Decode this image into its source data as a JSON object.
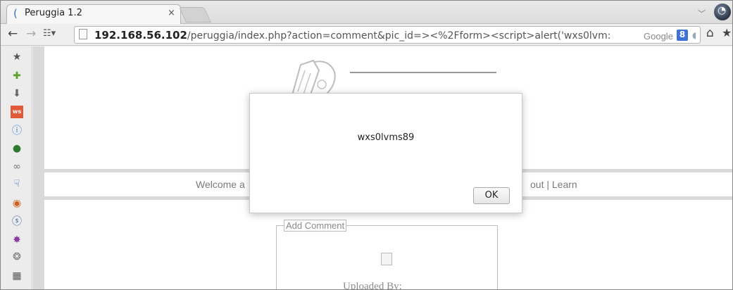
{
  "tab": {
    "title": "Peruggia 1.2",
    "close": "×",
    "dropdown": "﹀"
  },
  "nav": {
    "back": "←",
    "forward": "→",
    "grid": "☷▾"
  },
  "url": {
    "host": "192.168.56.102",
    "path": "/peruggia/index.php?action=comment&pic_id=><%2Fform><script>alert('wxs0lvm:",
    "search_engine": "Google",
    "google_badge": "8"
  },
  "toolbar": {
    "home": "⌂",
    "bookmarks": "★"
  },
  "sidebar": {
    "icons": [
      "star-icon",
      "puzzle-icon",
      "download-icon",
      "ws-icon",
      "info-icon",
      "bug-icon",
      "glasses-icon",
      "pointer-icon",
      "firebug-icon",
      "snail-icon",
      "gear-star-icon",
      "palette-icon",
      "calculator-icon"
    ],
    "glyphs": [
      "★",
      "✚",
      "⬇",
      "ws",
      "ⓘ",
      "●",
      "∞",
      "☟",
      "◉",
      "ⓢ",
      "✸",
      "❂",
      "▦"
    ],
    "colors": [
      "#555555",
      "#5aa02c",
      "#666666",
      "#e05a3a",
      "#3b7bd6",
      "#2e7a2e",
      "#777777",
      "#3b6fb8",
      "#d06020",
      "#3a5fa0",
      "#8a3aa0",
      "#777777",
      "#555555"
    ]
  },
  "page": {
    "welcome": "Welcome a",
    "links": "out | Learn",
    "comment_legend": "Add Comment",
    "uploaded_by": "Uploaded By:"
  },
  "dialog": {
    "message": "wxs0lvms89",
    "ok": "OK"
  }
}
